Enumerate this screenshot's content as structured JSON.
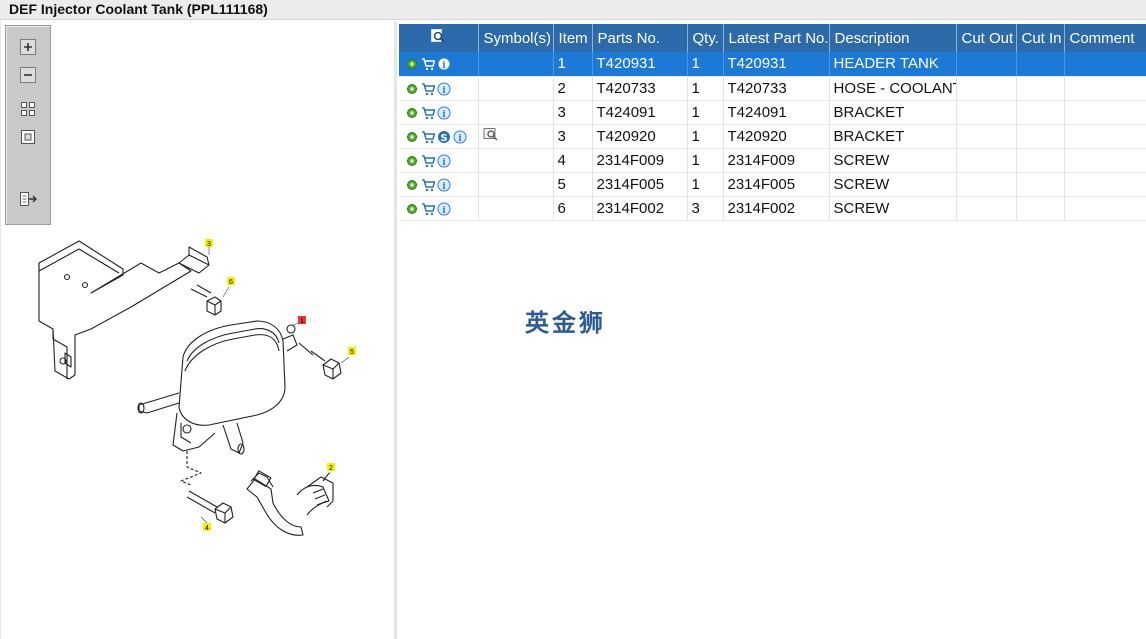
{
  "window": {
    "title": "DEF Injector Coolant Tank (PPL111168)"
  },
  "toolbar": {
    "icons": [
      "zoom-in-icon",
      "zoom-out-icon",
      "fit-all-icon",
      "fit-window-icon",
      "export-icon"
    ]
  },
  "diagram": {
    "callouts": [
      {
        "label": "3",
        "color": "#f5f000"
      },
      {
        "label": "6",
        "color": "#f5f000"
      },
      {
        "label": "1",
        "color": "#e83a3a"
      },
      {
        "label": "5",
        "color": "#f5f000"
      },
      {
        "label": "2",
        "color": "#f5f000"
      },
      {
        "label": "4",
        "color": "#f5f000"
      }
    ]
  },
  "grid": {
    "headers": {
      "symbols": "Symbol(s)",
      "item": "Item",
      "parts_no": "Parts No.",
      "qty": "Qty.",
      "latest": "Latest Part No.",
      "description": "Description",
      "cut_out": "Cut Out",
      "cut_in": "Cut In",
      "comment": "Comment"
    },
    "rows": [
      {
        "item": "1",
        "parts_no": "T420931",
        "qty": "1",
        "latest": "T420931",
        "description": "HEADER TANK"
      },
      {
        "item": "2",
        "parts_no": "T420733",
        "qty": "1",
        "latest": "T420733",
        "description": "HOSE - COOLANT"
      },
      {
        "item": "3",
        "parts_no": "T424091",
        "qty": "1",
        "latest": "T424091",
        "description": "BRACKET"
      },
      {
        "item": "3",
        "parts_no": "T420920",
        "qty": "1",
        "latest": "T420920",
        "description": "BRACKET"
      },
      {
        "item": "4",
        "parts_no": "2314F009",
        "qty": "1",
        "latest": "2314F009",
        "description": "SCREW"
      },
      {
        "item": "5",
        "parts_no": "2314F005",
        "qty": "1",
        "latest": "2314F005",
        "description": "SCREW"
      },
      {
        "item": "6",
        "parts_no": "2314F002",
        "qty": "3",
        "latest": "2314F002",
        "description": "SCREW"
      }
    ],
    "selected_row": 1,
    "colors": {
      "header": "#2d6aa9",
      "selected": "#1c7ad6",
      "gear": "#4caf20",
      "cart": "#2a6fb5",
      "info": "#2a7fd0"
    }
  },
  "watermark": {
    "text": "英金狮"
  }
}
